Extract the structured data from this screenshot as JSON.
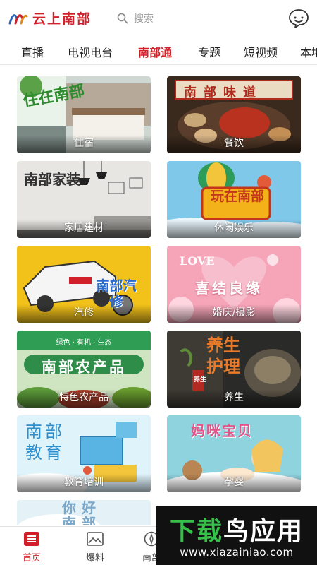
{
  "app": {
    "name": "云上南部"
  },
  "header": {
    "search_placeholder": "搜索",
    "logo_text": "云上南部"
  },
  "tabs": [
    {
      "label": "直播",
      "active": false
    },
    {
      "label": "电视电台",
      "active": false
    },
    {
      "label": "南部通",
      "active": true
    },
    {
      "label": "专题",
      "active": false
    },
    {
      "label": "短视频",
      "active": false
    },
    {
      "label": "本地",
      "active": false
    }
  ],
  "tiles": [
    {
      "caption": "住宿",
      "big": "住在南部"
    },
    {
      "caption": "餐饮",
      "big": "南部味道"
    },
    {
      "caption": "家居建材",
      "big": "南部家装"
    },
    {
      "caption": "休闲娱乐",
      "big": "玩在南部"
    },
    {
      "caption": "汽修",
      "big": "南部汽修"
    },
    {
      "caption": "婚庆/摄影",
      "big": "喜结良缘",
      "extra": "LOVE"
    },
    {
      "caption": "特色农产品",
      "big": "南部农产品",
      "extra": "绿色 · 有机 · 生态"
    },
    {
      "caption": "养生",
      "big": "养生护理",
      "extra": "养生"
    },
    {
      "caption": "教育培训",
      "big": "南部教育"
    },
    {
      "caption": "孕婴",
      "big": "妈咪宝贝"
    },
    {
      "caption": "",
      "big": "你好南部"
    }
  ],
  "bottom_nav": [
    {
      "label": "首页",
      "active": true,
      "icon": "home-icon"
    },
    {
      "label": "爆料",
      "active": false,
      "icon": "image-icon"
    },
    {
      "label": "南部",
      "active": false,
      "icon": "compass-icon"
    }
  ],
  "watermark": {
    "title_green": "下载",
    "title_white": "鸟应用",
    "url": "www.xiazainiao.com"
  },
  "colors": {
    "accent": "#d2202a",
    "divider": "#e6e6e6"
  }
}
